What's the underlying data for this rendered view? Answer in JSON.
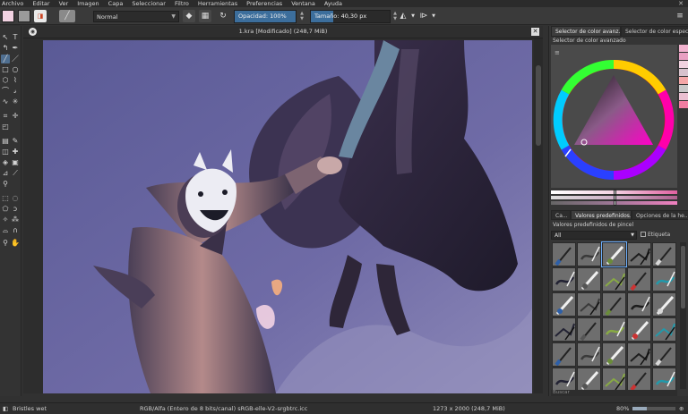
{
  "menu": [
    "Archivo",
    "Editar",
    "Ver",
    "Imagen",
    "Capa",
    "Seleccionar",
    "Filtro",
    "Herramientas",
    "Preferencias",
    "Ventana",
    "Ayuda"
  ],
  "window": {
    "close_glyph": "✕"
  },
  "options": {
    "blend_mode": "Normal",
    "opacity_label": "Opacidad:",
    "opacity_value": "100%",
    "opacity_fraction": 1.0,
    "size_label": "Tamaño:",
    "size_value": "40,30 px",
    "size_fraction": 0.28,
    "fg_color": "#f3d3e3",
    "bg_color": "#9a9a9a"
  },
  "document": {
    "title": "1.kra [Modificado]  (248,7 MiB)",
    "close_glyph": "✕"
  },
  "docker": {
    "tabs": [
      "Selector de color avanz...",
      "Selector de color especif..."
    ],
    "advanced_title": "Selector de color avanzado",
    "side_swatches": [
      "#f2b3cf",
      "#e9a0c2",
      "#f1d2df",
      "#d7c2cc",
      "#f4a7a7",
      "#c8c8c8",
      "#eac0d1",
      "#f07da1"
    ],
    "preset_tabs": [
      "Ca...",
      "Valores predefinidos...",
      "Opciones de la he..."
    ],
    "presets_title": "Valores predefinidos de pincel",
    "filter": "All",
    "tag_label": "Etiqueta",
    "search_placeholder": "Buscar"
  },
  "status": {
    "brush": "Bristles wet",
    "color_space": "RGB/Alfa (Entero de 8 bits/canal)  sRGB-elle-V2-srgbtrc.icc",
    "dimensions": "1273 x 2000 (248,7 MiB)",
    "zoom": "80%",
    "zoom_fraction": 0.33
  }
}
